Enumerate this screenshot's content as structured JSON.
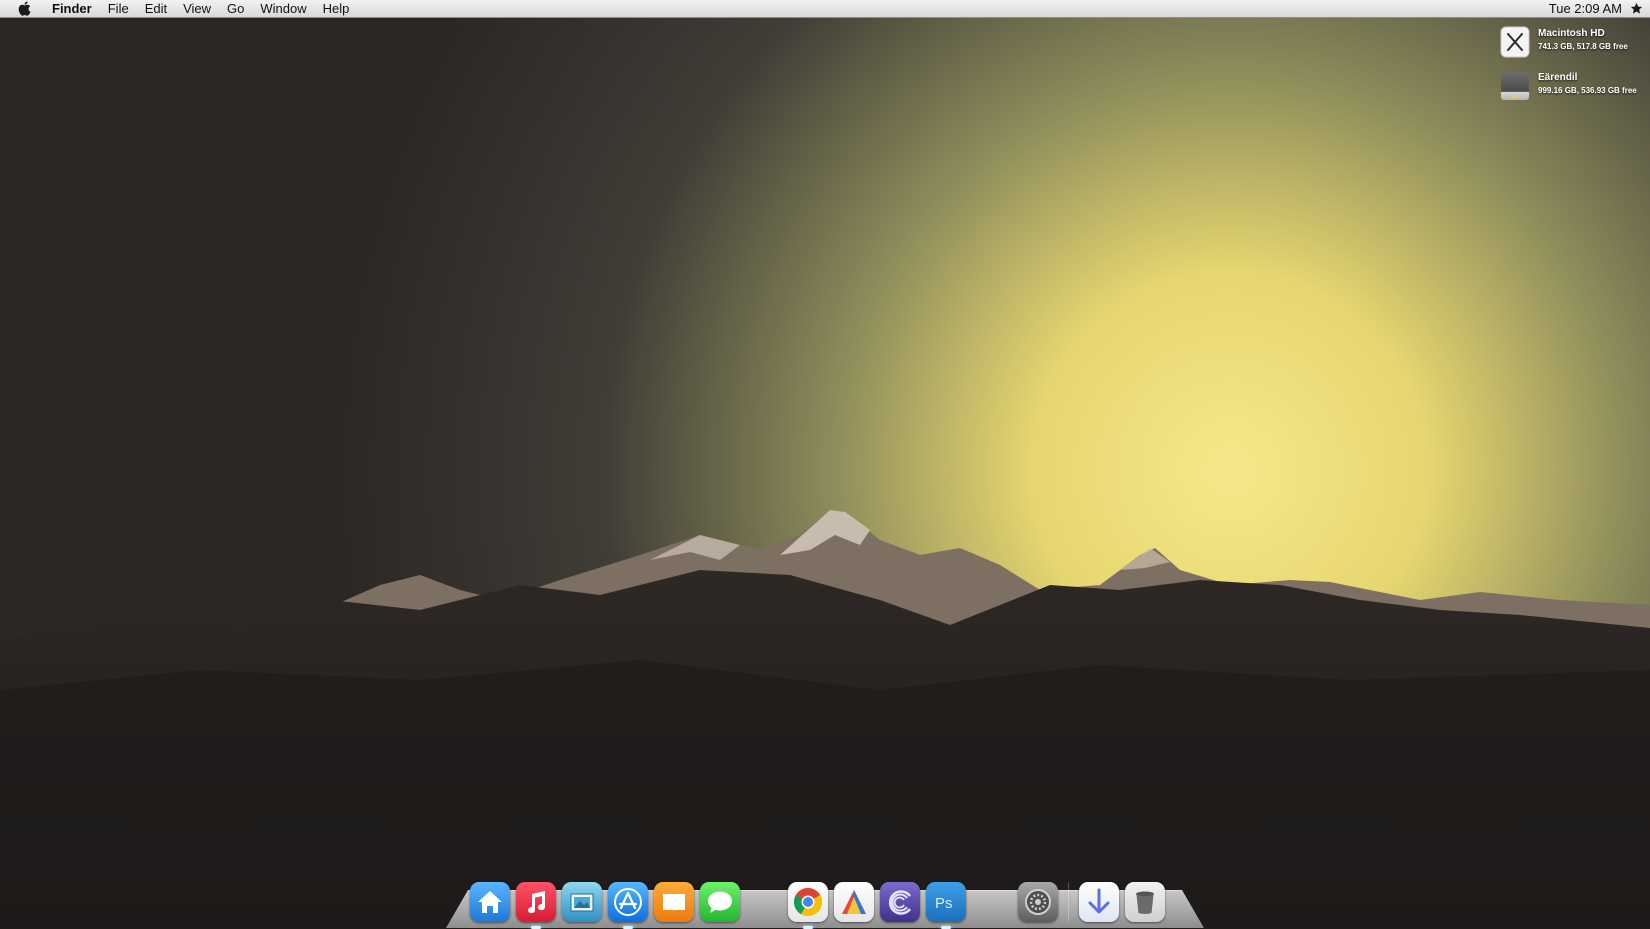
{
  "menubar": {
    "app_name": "Finder",
    "menus": [
      "File",
      "Edit",
      "View",
      "Go",
      "Window",
      "Help"
    ],
    "clock": "Tue 2:09 AM"
  },
  "desktop": {
    "drives": [
      {
        "name": "Macintosh HD",
        "info": "741.3 GB, 517.8 GB free",
        "icon": "osx-drive-icon"
      },
      {
        "name": "Eärendil",
        "info": "999.16 GB, 536.93 GB free",
        "icon": "external-drive-icon"
      }
    ]
  },
  "dock": {
    "items": [
      {
        "name": "home-icon",
        "color": "#2a8fe6"
      },
      {
        "name": "itunes-icon",
        "color": "#e8233a"
      },
      {
        "name": "preview-icon",
        "color": "#3ca8d8"
      },
      {
        "name": "app-store-icon",
        "color": "#1c8ef0"
      },
      {
        "name": "ibooks-icon",
        "color": "#f08a1c"
      },
      {
        "name": "messages-icon",
        "color": "#3fd24a"
      },
      {
        "name": "chrome-icon",
        "color": "#ffffff"
      },
      {
        "name": "affinity-designer-icon",
        "color": "#ececec"
      },
      {
        "name": "cocktail-icon",
        "color": "#5b4fa0"
      },
      {
        "name": "photoshop-icon",
        "color": "#2d8ad1"
      },
      {
        "name": "system-preferences-icon",
        "color": "#8d8d8d"
      },
      {
        "name": "downloads-icon",
        "color": "#e9eef8"
      },
      {
        "name": "trash-icon",
        "color": "#d9d9d9"
      }
    ]
  }
}
